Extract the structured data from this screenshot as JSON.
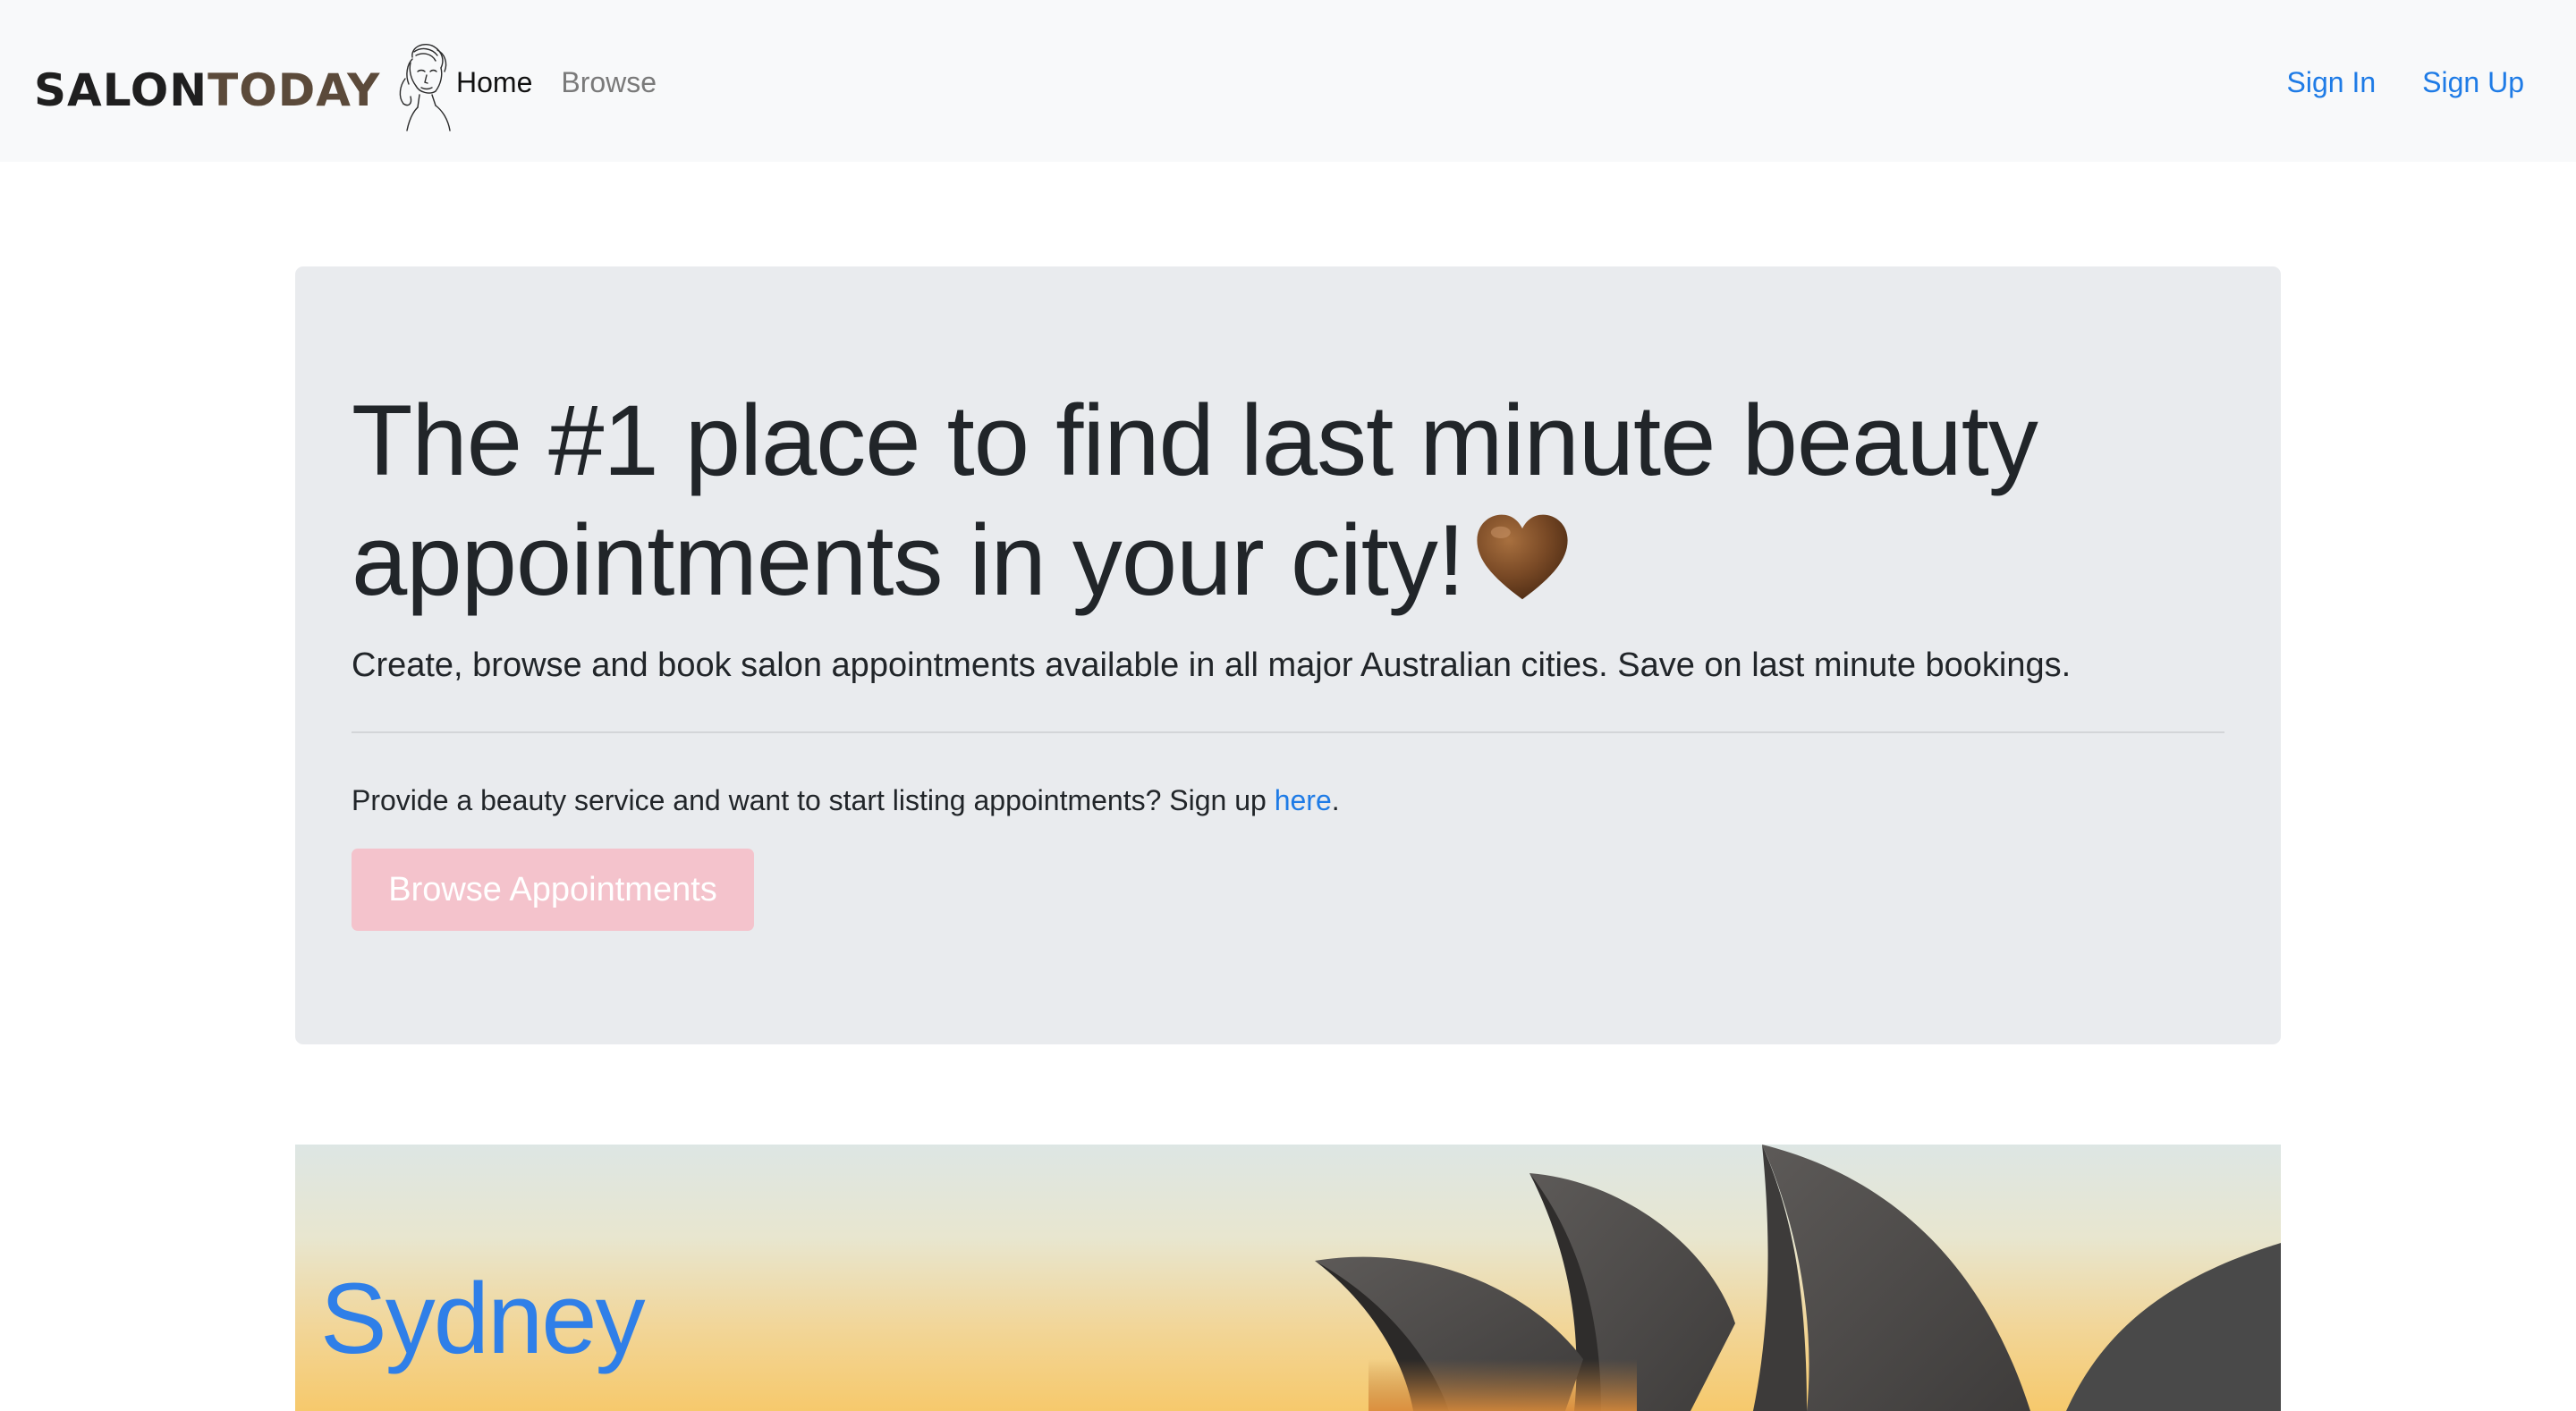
{
  "navbar": {
    "brand": {
      "part1": "SALON",
      "part2": "TODAY"
    },
    "links": [
      {
        "label": "Home",
        "state": "active"
      },
      {
        "label": "Browse",
        "state": "muted"
      }
    ],
    "auth": {
      "sign_in": "Sign In",
      "sign_up": "Sign Up"
    }
  },
  "hero": {
    "headline_line1": "The #1 place to find last minute beauty",
    "headline_line2": "appointments in your city!",
    "heart_icon": "brown-heart-icon",
    "lead": "Create, browse and book salon appointments available in all major Australian cities. Save on last minute bookings.",
    "provide_text": "Provide a beauty service and want to start listing appointments? Sign up ",
    "provide_link": "here",
    "provide_end": ".",
    "button_label": "Browse Appointments"
  },
  "city": {
    "name": "Sydney"
  },
  "colors": {
    "link": "#1e7be6",
    "button": "#f4c3cc",
    "jumbotron_bg": "#e9ebee",
    "navbar_bg": "#f8f9fa",
    "heart": "#7a4a26"
  }
}
